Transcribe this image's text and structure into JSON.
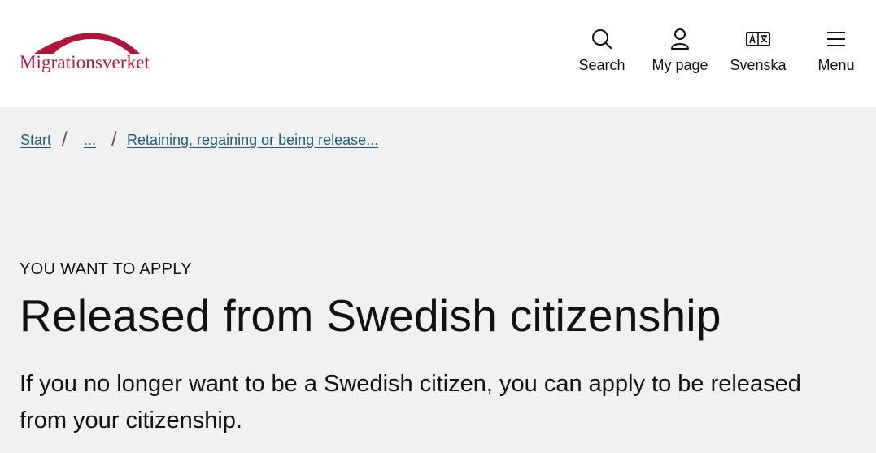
{
  "brand": {
    "name": "Migrationsverket",
    "color": "#b1163a"
  },
  "nav": {
    "search": {
      "label": "Search",
      "icon": "search-icon"
    },
    "my_page": {
      "label": "My page",
      "icon": "user-icon"
    },
    "language": {
      "label": "Svenska",
      "icon": "translate-icon"
    },
    "menu": {
      "label": "Menu",
      "icon": "hamburger-menu-icon"
    }
  },
  "breadcrumb": {
    "items": [
      "Start",
      "...",
      "Retaining, regaining or being release..."
    ],
    "separator": "/",
    "link_color": "#1a5c84"
  },
  "main": {
    "kicker": "YOU WANT TO APPLY",
    "title": "Released from Swedish citizenship",
    "lead": "If you no longer want to be a Swedish citizen, you can apply to be released from your citizenship."
  }
}
